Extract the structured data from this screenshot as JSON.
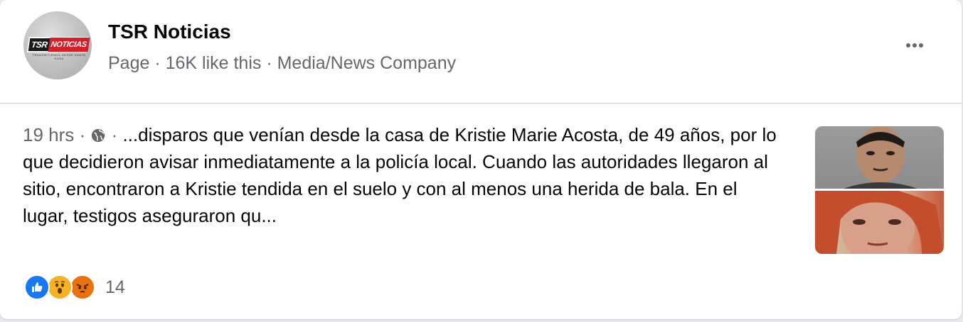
{
  "header": {
    "page_name": "TSR Noticias",
    "meta": "Page · 16K like this · Media/News Company",
    "logo": {
      "brand": "TSR",
      "brand_highlight": "NOTICIAS",
      "tagline": "TRANSMITIENDO DESDE SANTA ROSA"
    }
  },
  "post": {
    "time": "19 hrs",
    "separator": " · ",
    "text": "...disparos que venían desde la casa de Kristie Marie Acosta, de 49 años, por lo que decidieron avisar inmediatamente a la policía local. Cuando las autoridades llegaron al sitio, encontraron a Kristie tendida en el suelo y con al menos una herida de bala. En el lugar, testigos aseguraron qu..."
  },
  "reactions": {
    "icons": [
      "like-icon",
      "wow-icon",
      "angry-icon"
    ],
    "count": "14"
  },
  "colors": {
    "like": "#1877f2",
    "wow": "#f7b125",
    "angry": "#e9710f",
    "logo_red": "#d3202a",
    "secondary_text": "#65676b"
  }
}
